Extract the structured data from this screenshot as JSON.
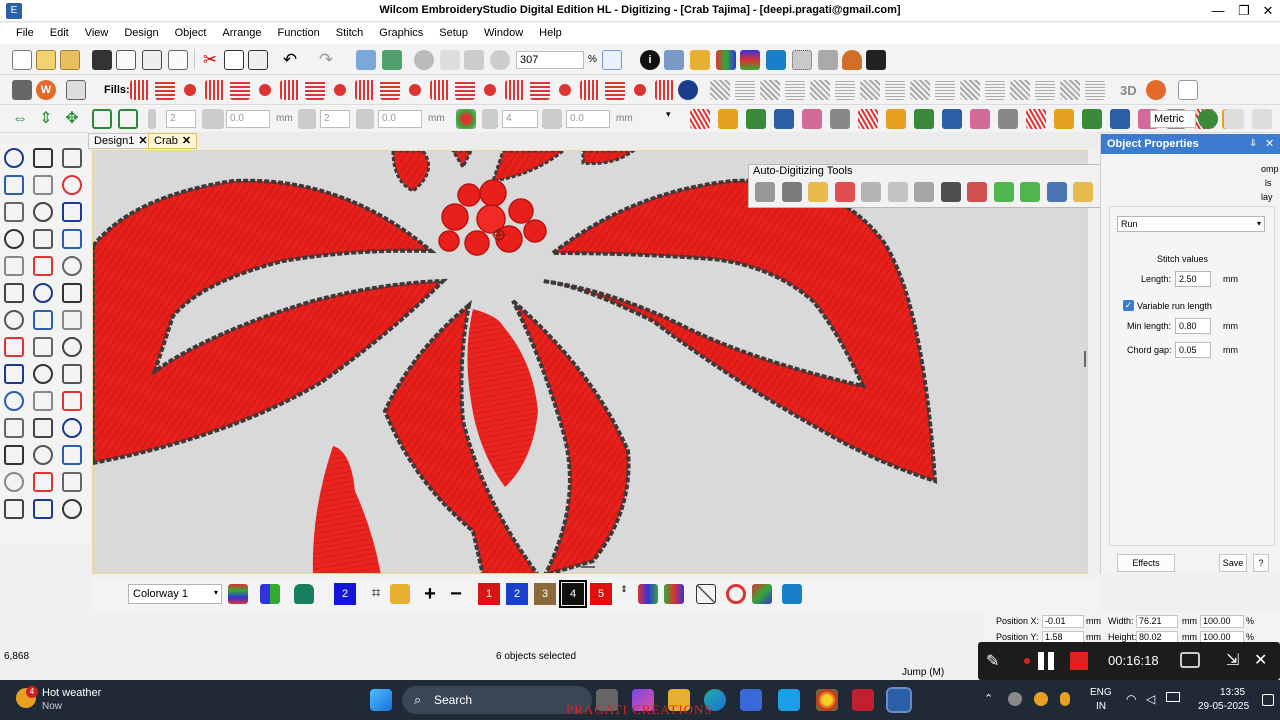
{
  "window": {
    "title": "Wilcom EmbroideryStudio Digital Edition HL - Digitizing - [Crab          Tajima] - [deepi.pragati@gmail.com]",
    "minimize": "—",
    "restore": "❐",
    "close": "✕"
  },
  "menu": [
    "File",
    "Edit",
    "View",
    "Design",
    "Object",
    "Arrange",
    "Function",
    "Stitch",
    "Graphics",
    "Setup",
    "Window",
    "Help"
  ],
  "toolbar": {
    "zoom_value": "307",
    "zoom_unit": "%",
    "fills_label": "Fills:",
    "spin_a": "2",
    "spin_b": "0.0",
    "spin_c": "2",
    "spin_d": "0.0",
    "spin_e": "4",
    "spin_f": "0.0",
    "unit_mm": "mm",
    "units_select": "Metric",
    "three_d": "3D"
  },
  "tabs": [
    {
      "label": "Design1",
      "close": "✕"
    },
    {
      "label": "Crab",
      "close": "✕"
    }
  ],
  "auto_digitizing": {
    "title": "Auto-Digitizing Tools",
    "close": "✕"
  },
  "object_properties": {
    "title": "Object Properties",
    "partial_labels": [
      "omp",
      "ls",
      "lay"
    ],
    "stitch_type": "Run",
    "stitch_values_heading": "Stitch values",
    "length_label": "Length:",
    "length_value": "2.50",
    "variable_run_label": "Variable run length",
    "variable_run_checked": true,
    "min_length_label": "Min length:",
    "min_length_value": "0.80",
    "chord_gap_label": "Chord gap:",
    "chord_gap_value": "0.05",
    "unit": "mm",
    "effects_button": "Effects",
    "save_button": "Save",
    "help_button": "?"
  },
  "colorway": {
    "selected": "Colorway 1",
    "swatches": [
      {
        "label": "2",
        "color": "#1515d6"
      },
      {
        "label": "1",
        "color": "#d81414"
      },
      {
        "label": "2",
        "color": "#1a3fcf"
      },
      {
        "label": "3",
        "color": "#8a6a3a"
      },
      {
        "label": "4",
        "color": "#111111"
      },
      {
        "label": "5",
        "color": "#e01010"
      }
    ]
  },
  "position": {
    "pos_x_label": "Position X:",
    "pos_x": "-0.01",
    "pos_y_label": "Position Y:",
    "pos_y": "1.58",
    "width_label": "Width:",
    "width": "76.21",
    "height_label": "Height:",
    "height": "80.02",
    "unit": "mm",
    "pct_w": "100.00",
    "pct_h": "100.00",
    "pct": "%"
  },
  "status": {
    "stitch_count": "6,868",
    "selection": "6 objects selected",
    "mode": "Jump (M)"
  },
  "recorder": {
    "time": "00:16:18"
  },
  "taskbar": {
    "weather_title": "Hot weather",
    "weather_sub": "Now",
    "weather_badge": "4",
    "search": "Search",
    "watermark": "PRAGATI CREATIONS",
    "lang1": "ENG",
    "lang2": "IN",
    "time": "13:35",
    "date": "29-05-2025"
  }
}
